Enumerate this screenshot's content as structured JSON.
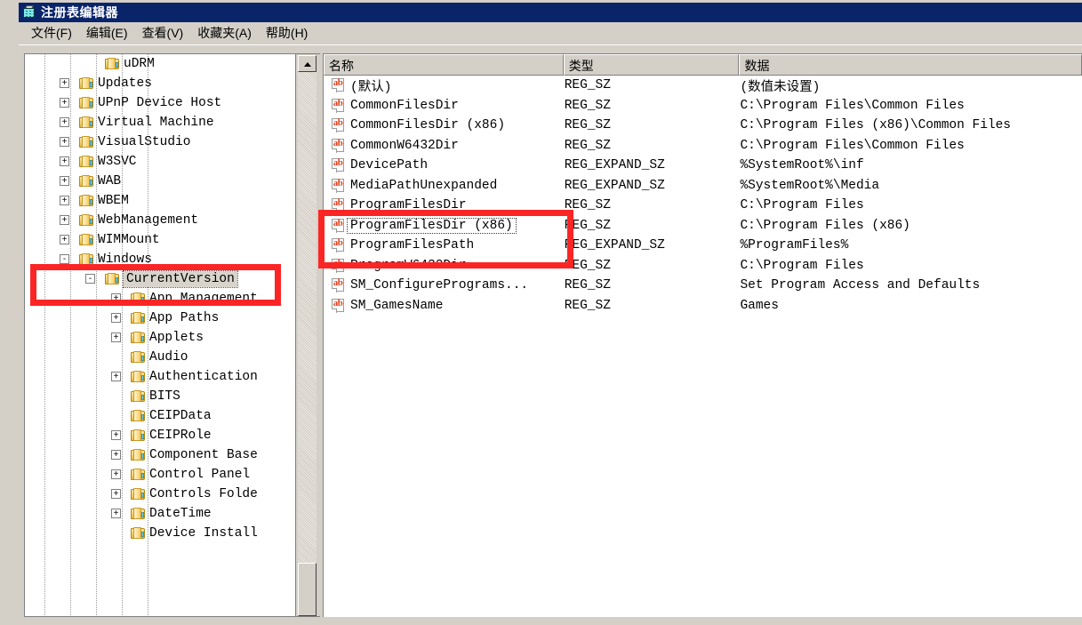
{
  "window": {
    "title": "注册表编辑器",
    "icon": "registry-editor-icon"
  },
  "menu": {
    "items": [
      {
        "label": "文件(F)",
        "name": "menu-file"
      },
      {
        "label": "编辑(E)",
        "name": "menu-edit"
      },
      {
        "label": "查看(V)",
        "name": "menu-view"
      },
      {
        "label": "收藏夹(A)",
        "name": "menu-favorites"
      },
      {
        "label": "帮助(H)",
        "name": "menu-help"
      }
    ]
  },
  "tree": {
    "scrollbar": {
      "up_arrow": "▲"
    },
    "nodes": [
      {
        "label": "uDRM",
        "indent": 3,
        "expander": "",
        "selected": false
      },
      {
        "label": "Updates",
        "indent": 2,
        "expander": "+",
        "selected": false
      },
      {
        "label": "UPnP Device Host",
        "indent": 2,
        "expander": "+",
        "selected": false
      },
      {
        "label": "Virtual Machine",
        "indent": 2,
        "expander": "+",
        "selected": false
      },
      {
        "label": "VisualStudio",
        "indent": 2,
        "expander": "+",
        "selected": false
      },
      {
        "label": "W3SVC",
        "indent": 2,
        "expander": "+",
        "selected": false
      },
      {
        "label": "WAB",
        "indent": 2,
        "expander": "+",
        "selected": false
      },
      {
        "label": "WBEM",
        "indent": 2,
        "expander": "+",
        "selected": false
      },
      {
        "label": "WebManagement",
        "indent": 2,
        "expander": "+",
        "selected": false
      },
      {
        "label": "WIMMount",
        "indent": 2,
        "expander": "+",
        "selected": false
      },
      {
        "label": "Windows",
        "indent": 2,
        "expander": "-",
        "selected": false
      },
      {
        "label": "CurrentVersion",
        "indent": 3,
        "expander": "-",
        "selected": true
      },
      {
        "label": "App Management",
        "indent": 4,
        "expander": "+",
        "selected": false
      },
      {
        "label": "App Paths",
        "indent": 4,
        "expander": "+",
        "selected": false
      },
      {
        "label": "Applets",
        "indent": 4,
        "expander": "+",
        "selected": false
      },
      {
        "label": "Audio",
        "indent": 4,
        "expander": "",
        "selected": false
      },
      {
        "label": "Authentication",
        "indent": 4,
        "expander": "+",
        "selected": false
      },
      {
        "label": "BITS",
        "indent": 4,
        "expander": "",
        "selected": false
      },
      {
        "label": "CEIPData",
        "indent": 4,
        "expander": "",
        "selected": false
      },
      {
        "label": "CEIPRole",
        "indent": 4,
        "expander": "+",
        "selected": false
      },
      {
        "label": "Component Base",
        "indent": 4,
        "expander": "+",
        "selected": false
      },
      {
        "label": "Control Panel",
        "indent": 4,
        "expander": "+",
        "selected": false
      },
      {
        "label": "Controls Folde",
        "indent": 4,
        "expander": "+",
        "selected": false
      },
      {
        "label": "DateTime",
        "indent": 4,
        "expander": "+",
        "selected": false
      },
      {
        "label": "Device Install",
        "indent": 4,
        "expander": "",
        "selected": false
      }
    ]
  },
  "list": {
    "columns": [
      {
        "label": "名称",
        "name": "column-name"
      },
      {
        "label": "类型",
        "name": "column-type"
      },
      {
        "label": "数据",
        "name": "column-data"
      }
    ],
    "rows": [
      {
        "icon": "string-value-icon",
        "name": "(默认)",
        "type": "REG_SZ",
        "data": "(数值未设置)",
        "focused": false
      },
      {
        "icon": "string-value-icon",
        "name": "CommonFilesDir",
        "type": "REG_SZ",
        "data": "C:\\Program Files\\Common Files",
        "focused": false
      },
      {
        "icon": "string-value-icon",
        "name": "CommonFilesDir (x86)",
        "type": "REG_SZ",
        "data": "C:\\Program Files (x86)\\Common Files",
        "focused": false
      },
      {
        "icon": "string-value-icon",
        "name": "CommonW6432Dir",
        "type": "REG_SZ",
        "data": "C:\\Program Files\\Common Files",
        "focused": false
      },
      {
        "icon": "string-value-icon",
        "name": "DevicePath",
        "type": "REG_EXPAND_SZ",
        "data": "%SystemRoot%\\inf",
        "focused": false
      },
      {
        "icon": "string-value-icon",
        "name": "MediaPathUnexpanded",
        "type": "REG_EXPAND_SZ",
        "data": "%SystemRoot%\\Media",
        "focused": false
      },
      {
        "icon": "string-value-icon",
        "name": "ProgramFilesDir",
        "type": "REG_SZ",
        "data": "C:\\Program Files",
        "focused": false
      },
      {
        "icon": "string-value-icon",
        "name": "ProgramFilesDir (x86)",
        "type": "REG_SZ",
        "data": "C:\\Program Files (x86)",
        "focused": true
      },
      {
        "icon": "string-value-icon",
        "name": "ProgramFilesPath",
        "type": "REG_EXPAND_SZ",
        "data": "%ProgramFiles%",
        "focused": false
      },
      {
        "icon": "string-value-icon",
        "name": "ProgramW6432Dir",
        "type": "REG_SZ",
        "data": "C:\\Program Files",
        "focused": false
      },
      {
        "icon": "string-value-icon",
        "name": "SM_ConfigurePrograms...",
        "type": "REG_SZ",
        "data": "Set Program Access and Defaults",
        "focused": false
      },
      {
        "icon": "string-value-icon",
        "name": "SM_GamesName",
        "type": "REG_SZ",
        "data": "Games",
        "focused": false
      }
    ]
  },
  "annotations": {
    "highlight_color": "#fb2525",
    "boxes": [
      {
        "name": "highlight-currentversion-key"
      },
      {
        "name": "highlight-programfilesdir-values"
      }
    ]
  }
}
